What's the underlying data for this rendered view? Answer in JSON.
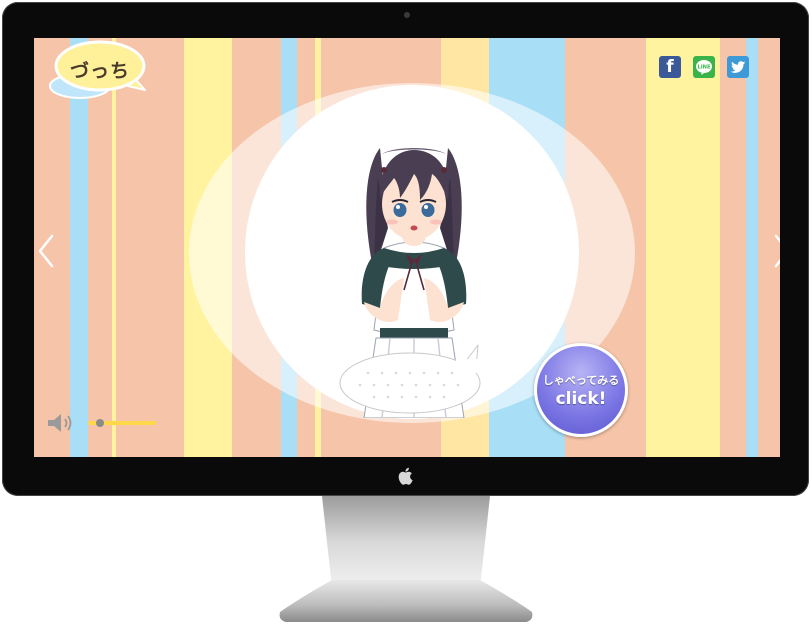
{
  "app": {
    "logo_text": "づっち"
  },
  "share": {
    "facebook_glyph": "f",
    "line_glyph": "LINE"
  },
  "talk_button": {
    "label_jp": "しゃべってみる",
    "label_en": "click!"
  },
  "volume": {
    "level": 0.18
  },
  "colors": {
    "peach": "#f6c4a8",
    "yellow": "#fff3a0",
    "sky": "#a9def7",
    "button": "#7d78e5",
    "slider": "#ffd84a",
    "facebook": "#3b5998",
    "line": "#3ab44a",
    "twitter": "#3d9ad6"
  },
  "icons": {
    "sound": "speaker-icon",
    "prev": "chevron-left-icon",
    "next": "chevron-right-icon",
    "apple": "apple-logo-icon"
  }
}
